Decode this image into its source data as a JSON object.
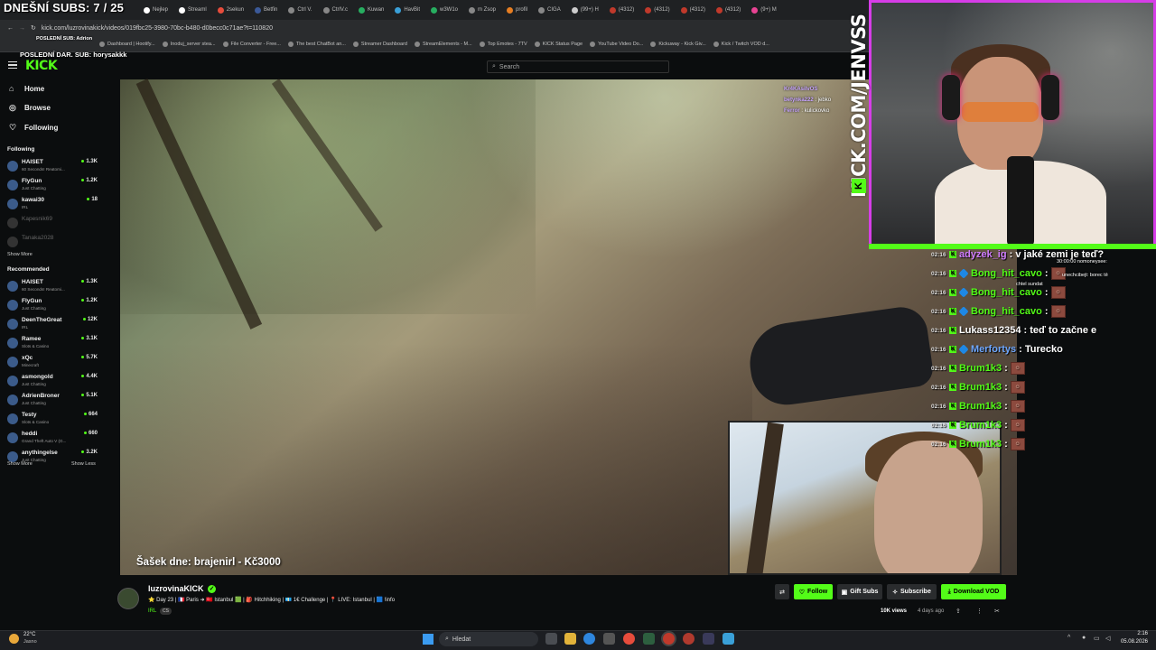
{
  "overlay": {
    "subs_title": "DNEŠNÍ SUBS: 7 / 25",
    "last_sub": "POSLEDNÍ SUB: Adrion",
    "last_donation": "POSLEDNÍ DAR. SUB: horysakkk",
    "kick_url": "KICK.COM/JENVSS",
    "video_caption": "Šašek dne: brajenirl - Kč3000",
    "mini_chat": [
      {
        "user": "Kr4KAsilvOS",
        "msg": ""
      },
      {
        "user": "betynka222",
        "msg": "jebko"
      },
      {
        "user": "Ferror",
        "msg": "kulickovko"
      }
    ],
    "notifications": [
      "30:00:00 nomoneysee:",
      "unechcibejt: borec tě",
      "chtel sundat"
    ]
  },
  "browser": {
    "tabs": [
      "Nejlep",
      "Streaml",
      "2sekun",
      "Betfin",
      "Ctrl V.",
      "CtrlV.c",
      "Kuwan",
      "HavBit",
      "w3W1o",
      "m Zsop",
      "profil",
      "CIGA",
      "(99+) H",
      "(4312)",
      "(4312)",
      "(4312)",
      "(4312)",
      "(9+) M"
    ],
    "url": "kick.com/luzrovinakick/videos/019fbc25-3980-70bc-b480-d0becc0c71ae?t=110820",
    "bookmarks": [
      "Dashboard | Hootify...",
      "Inoduj_server stea...",
      "File Converter - Free...",
      "The best ChatBot an...",
      "Streamer Dashboard",
      "StreamElements - M...",
      "Top Emotes - 7TV",
      "KICK Status Page",
      "YouTube Video Do...",
      "Kickuway - Kick Giv...",
      "Kick / Twitch VOD d..."
    ]
  },
  "header": {
    "logo": "KICK",
    "search_placeholder": "Search"
  },
  "sidebar": {
    "nav": [
      {
        "label": "Home",
        "icon": "home-icon"
      },
      {
        "label": "Browse",
        "icon": "compass-icon"
      },
      {
        "label": "Following",
        "icon": "heart-icon"
      }
    ],
    "following_title": "Following",
    "following": [
      {
        "name": "HAISET",
        "category": "60 Seconds! Reatomi...",
        "viewers": "1.3K",
        "live": true
      },
      {
        "name": "FlyGun",
        "category": "Just Chatting",
        "viewers": "1.2K",
        "live": true
      },
      {
        "name": "kawai30",
        "category": "IRL",
        "viewers": "18",
        "live": true
      },
      {
        "name": "Kapesnik69",
        "category": "",
        "viewers": "",
        "live": false
      },
      {
        "name": "Tanaka2028",
        "category": "",
        "viewers": "",
        "live": false
      }
    ],
    "following_more": "Show More",
    "recommended_title": "Recommended",
    "recommended": [
      {
        "name": "HAISET",
        "category": "60 Seconds! Reatomi...",
        "viewers": "1.3K"
      },
      {
        "name": "FlyGun",
        "category": "Just Chatting",
        "viewers": "1.2K"
      },
      {
        "name": "DeenTheGreat",
        "category": "IRL",
        "viewers": "12K"
      },
      {
        "name": "Ramee",
        "category": "Slots & Casino",
        "viewers": "3.1K"
      },
      {
        "name": "xQc",
        "category": "Minecraft",
        "viewers": "5.7K"
      },
      {
        "name": "asmongold",
        "category": "Just Chatting",
        "viewers": "4.4K"
      },
      {
        "name": "AdrienBroner",
        "category": "Just Chatting",
        "viewers": "5.1K"
      },
      {
        "name": "Testy",
        "category": "Slots & Casino",
        "viewers": "664"
      },
      {
        "name": "heddi",
        "category": "Grand Theft Auto V (G...",
        "viewers": "660"
      },
      {
        "name": "anythingelse",
        "category": "Just Chatting",
        "viewers": "3.2K"
      }
    ],
    "recommended_more": "Show More",
    "recommended_less": "Show Less"
  },
  "chat_overlay": [
    {
      "time": "02:16",
      "user": "adyzek_ig",
      "color": "#d07cff",
      "msg": ": v jaké zemi je teď?"
    },
    {
      "time": "02:16",
      "user": "Bong_hit_cavo",
      "color": "#53fc18",
      "msg": ":"
    },
    {
      "time": "02:16",
      "user": "Bong_hit_cavo",
      "color": "#53fc18",
      "msg": ":"
    },
    {
      "time": "02:16",
      "user": "Bong_hit_cavo",
      "color": "#53fc18",
      "msg": ":"
    },
    {
      "time": "02:16",
      "user": "Lukass12354",
      "color": "#ffffff",
      "msg": ": teď to začne e"
    },
    {
      "time": "02:16",
      "user": "Merfortys",
      "color": "#6fa8ff",
      "msg": ": Turecko"
    },
    {
      "time": "02:16",
      "user": "Brum1k3",
      "color": "#53fc18",
      "msg": ":"
    },
    {
      "time": "02:16",
      "user": "Brum1k3",
      "color": "#53fc18",
      "msg": ":"
    },
    {
      "time": "02:16",
      "user": "Brum1k3",
      "color": "#53fc18",
      "msg": ":"
    },
    {
      "time": "02:16",
      "user": "Brum1k3",
      "color": "#53fc18",
      "msg": ":"
    },
    {
      "time": "02:16",
      "user": "Brum1k3",
      "color": "#53fc18",
      "msg": ":"
    }
  ],
  "stream_info": {
    "streamer": "luzrovinaKICK",
    "title": "⭐ Day 23 | 🇫🇷 Paris ➜ 🇹🇷 Istanbul 🟩 | 🎒 Hitchhiking | 💶 1€ Challenge | 📍 LIVE: Istanbul | 🟦 !info",
    "category": "IRL",
    "language": "CS",
    "views": "10K views",
    "ago": "4 days ago",
    "buttons": {
      "follow": "Follow",
      "gift": "Gift Subs",
      "subscribe": "Subscribe",
      "download": "Download VOD"
    }
  },
  "taskbar": {
    "temp": "22°C",
    "weather": "Jasno",
    "search": "Hledat",
    "time": "2:16",
    "date": "05.08.2026"
  },
  "colors": {
    "kick_green": "#53fc18",
    "background": "#0b0d0e",
    "webcam_border": "#d63de8"
  }
}
